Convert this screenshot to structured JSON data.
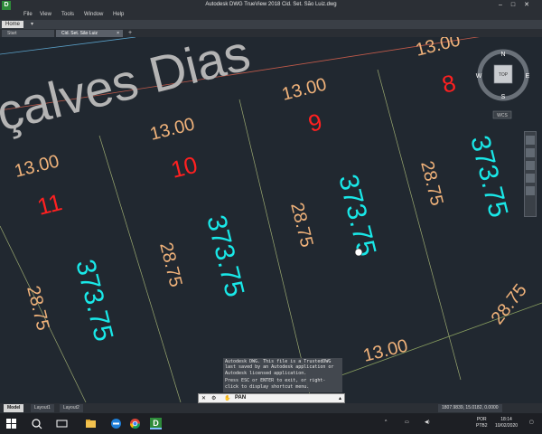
{
  "window": {
    "title": "Autodesk DWG TrueView 2018    Cid. Set. São Luiz.dwg",
    "app_icon_letter": "D",
    "min": "–",
    "max": "□",
    "close": "✕"
  },
  "menu": [
    "File",
    "View",
    "Tools",
    "Window",
    "Help"
  ],
  "ribbon": {
    "home_tab": "Home",
    "dropdown": "▾"
  },
  "doc_tabs": {
    "start": "Start",
    "file": "Cid. Set. São Luiz",
    "close": "×",
    "new": "+"
  },
  "drawing": {
    "street_name": "çalves Dias",
    "lots": [
      {
        "id": "11",
        "front": "13.00",
        "side": "28.75",
        "depth": "373.75"
      },
      {
        "id": "10",
        "front": "13.00",
        "side": "28.75",
        "depth": "373.75"
      },
      {
        "id": "9",
        "front": "13.00",
        "side": "28.75",
        "depth": "373.75"
      },
      {
        "id": "8",
        "front": "13.00",
        "side": "28.75",
        "depth": "373.75"
      }
    ],
    "bottom_dims": [
      "13.00",
      "28.75"
    ],
    "viewcube": {
      "top": "TOP",
      "n": "N",
      "s": "S",
      "e": "E",
      "w": "W",
      "wcs": "WCS"
    }
  },
  "command": {
    "history": [
      "Autodesk DWG.  This file is a TrustedDWG",
      "last saved by an Autodesk application or",
      "Autodesk licensed application.",
      "Press ESC or ENTER to exit, or right-",
      "click to display shortcut menu."
    ],
    "input": "PAN",
    "close": "✕",
    "wrench": "⚙"
  },
  "layouts": {
    "model": "Model",
    "layout1": "Layout1",
    "layout2": "Layout2"
  },
  "status": {
    "coords": "1807.9839, 15.0182, 0.0000"
  },
  "taskbar": {
    "lang": "POR",
    "kbd": "PTB2",
    "time": "18:14",
    "date": "10/02/2020",
    "dwg_icon": "D"
  }
}
